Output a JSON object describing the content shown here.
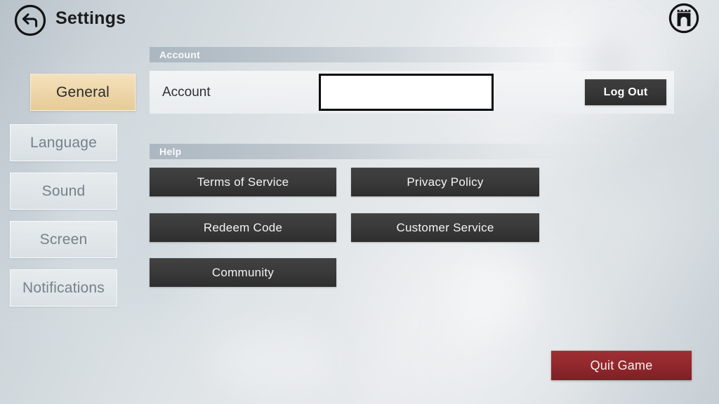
{
  "header": {
    "title": "Settings",
    "back_icon": "back-arrow-icon",
    "home_icon": "castle-home-icon"
  },
  "sidebar": {
    "items": [
      {
        "label": "General",
        "active": true
      },
      {
        "label": "Language",
        "active": false
      },
      {
        "label": "Sound",
        "active": false
      },
      {
        "label": "Screen",
        "active": false
      },
      {
        "label": "Notifications",
        "active": false
      }
    ]
  },
  "sections": {
    "account": {
      "heading": "Account",
      "row_label": "Account",
      "row_value": "",
      "logout_label": "Log Out"
    },
    "help": {
      "heading": "Help",
      "buttons": [
        "Terms of Service",
        "Privacy Policy",
        "Redeem Code",
        "Customer Service",
        "Community"
      ]
    }
  },
  "footer": {
    "quit_label": "Quit Game"
  },
  "colors": {
    "accent_active_tab": "#edd5a8",
    "button_dark": "#3a3a3a",
    "quit_red": "#93282d",
    "background": "#dfe4e7"
  }
}
